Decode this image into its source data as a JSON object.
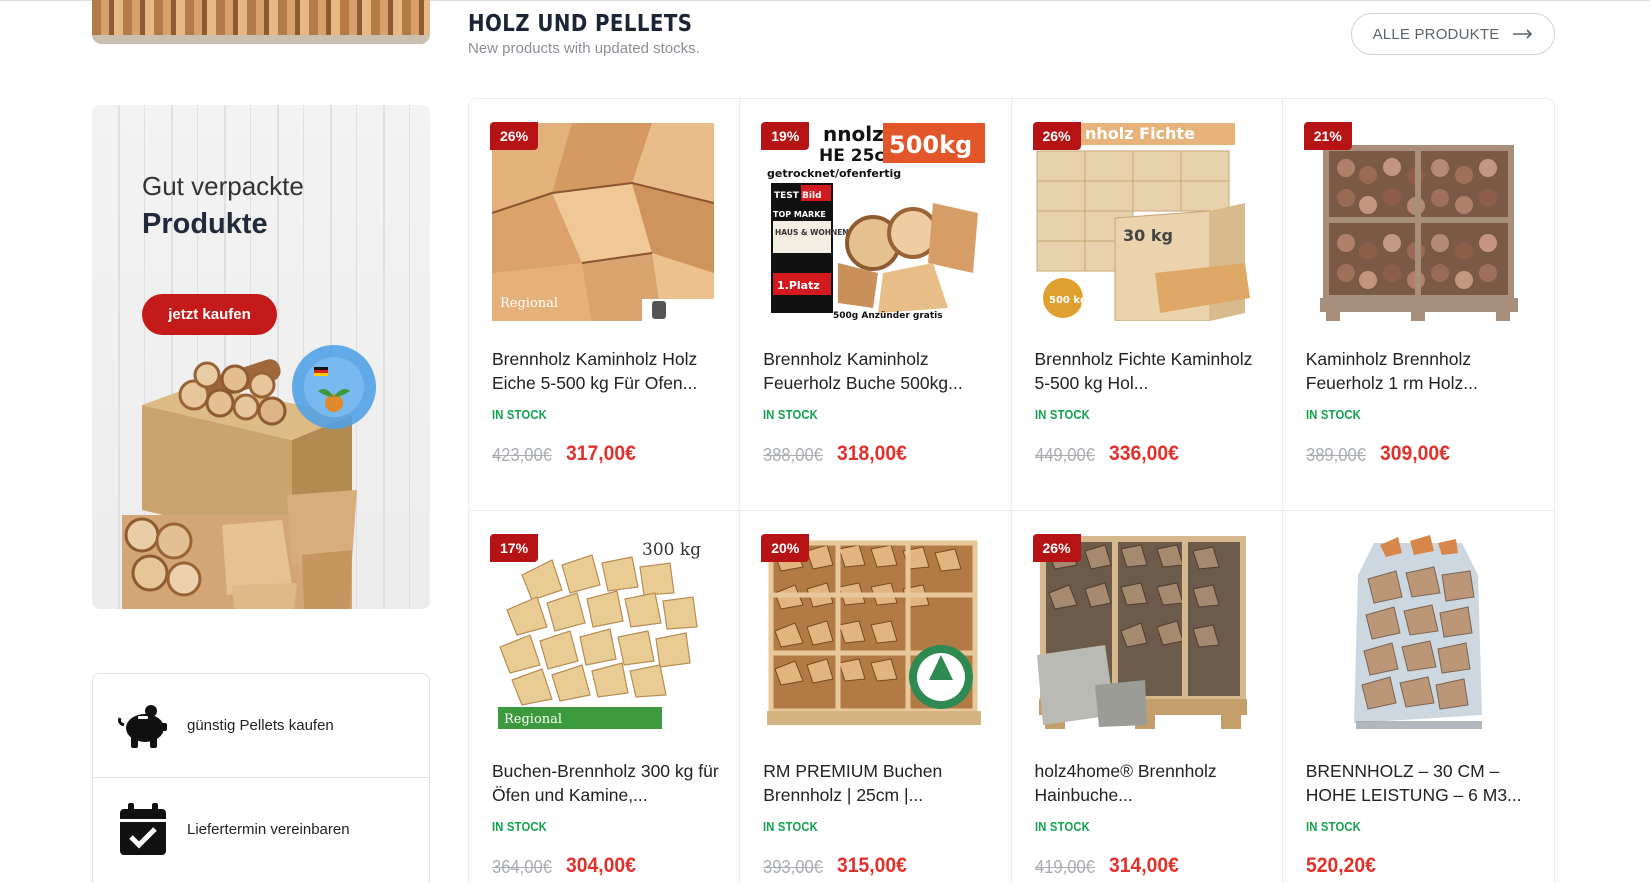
{
  "section": {
    "title": "HOLZ UND PELLETS",
    "subtitle": "New products with updated stocks.",
    "all_button": "ALLE PRODUKTE"
  },
  "promo": {
    "line1": "Gut verpackte",
    "line2": "Produkte",
    "button": "jetzt kaufen"
  },
  "features": [
    {
      "label": "günstig Pellets kaufen",
      "icon": "piggy-bank-icon"
    },
    {
      "label": "Liefertermin vereinbaren",
      "icon": "calendar-check-icon"
    }
  ],
  "colors": {
    "accent": "#c41a1a",
    "price": "#e0312b",
    "in_stock": "#12a24d",
    "badge": "#b61414"
  },
  "products": [
    {
      "badge": "26%",
      "title": "Brennholz Kaminholz Holz Eiche 5-500 kg Für Ofen...",
      "stock": "IN STOCK",
      "old_price": "423,00€",
      "price": "317,00€"
    },
    {
      "badge": "19%",
      "title": "Brennholz Kaminholz Feuerholz Buche 500kg...",
      "stock": "IN STOCK",
      "old_price": "388,00€",
      "price": "318,00€"
    },
    {
      "badge": "26%",
      "title": "Brennholz Fichte Kaminholz 5-500 kg Hol...",
      "stock": "IN STOCK",
      "old_price": "449,00€",
      "price": "336,00€"
    },
    {
      "badge": "21%",
      "title": "Kaminholz Brennholz Feuerholz 1 rm Holz...",
      "stock": "IN STOCK",
      "old_price": "389,00€",
      "price": "309,00€"
    },
    {
      "badge": "17%",
      "title": "Buchen-Brennholz 300 kg für Öfen und Kamine,...",
      "stock": "IN STOCK",
      "old_price": "364,00€",
      "price": "304,00€"
    },
    {
      "badge": "20%",
      "title": "RM PREMIUM Buchen Brennholz | 25cm |...",
      "stock": "IN STOCK",
      "old_price": "393,00€",
      "price": "315,00€"
    },
    {
      "badge": "26%",
      "title": "holz4home® Brennholz Hainbuche...",
      "stock": "IN STOCK",
      "old_price": "419,00€",
      "price": "314,00€"
    },
    {
      "badge": "",
      "title": "BRENNHOLZ – 30 CM – HOHE LEISTUNG – 6 M3...",
      "stock": "IN STOCK",
      "old_price": "",
      "price": "520,20€"
    }
  ],
  "image_text": {
    "p1": "Regional",
    "p2_big": "500kg",
    "p2_top": "nnolz",
    "p2_mid": "HE 25cm",
    "p2_sub": "getrocknet/ofenfertig",
    "p2_testbild": "TEST Bild",
    "p2_topmarke": "TOP MARKE",
    "p2_haus": "HAUS & WOHNEN",
    "p2_platz": "1.Platz",
    "p2_bottom": "500g Anzünder gratis",
    "p3_top": "nholz Fichte",
    "p3_kg": "30 kg",
    "p3_500": "500 kg",
    "p5_kg": "300 kg",
    "p5_regional": "Regional"
  }
}
